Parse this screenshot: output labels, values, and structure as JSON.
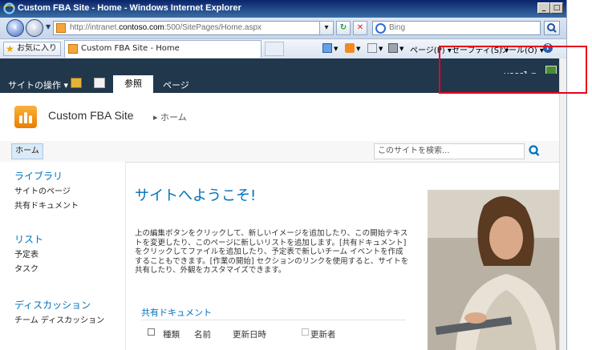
{
  "browser": {
    "window_title": "Custom FBA Site - Home - Windows Internet Explorer",
    "window_controls": [
      "_",
      "□",
      "×"
    ],
    "url_prefix": "http://intranet.",
    "url_domain": "contoso.com",
    "url_suffix": ":500/SitePages/Home.aspx",
    "search_placeholder": "Bing",
    "favorites_label": "お気に入り",
    "tab_label": "Custom FBA Site - Home",
    "cmd_page": "ページ(P)",
    "cmd_safety": "セーフティ(S)",
    "cmd_tools": "ツール(O)",
    "cmd_help": "?"
  },
  "ribbon": {
    "site_actions": "サイトの操作",
    "tab_browse": "参照",
    "tab_page": "ページ",
    "user": "user1"
  },
  "site": {
    "title": "Custom FBA Site",
    "breadcrumb": "ホーム",
    "nav_home": "ホーム",
    "search_placeholder": "このサイトを検索..."
  },
  "leftnav": {
    "libraries_heading": "ライブラリ",
    "site_pages": "サイトのページ",
    "shared_docs": "共有ドキュメント",
    "lists_heading": "リスト",
    "calendar": "予定表",
    "tasks": "タスク",
    "discussions_heading": "ディスカッション",
    "team_discussion": "チーム ディスカッション"
  },
  "main": {
    "welcome": "サイトへようこそ!",
    "description": "上の編集ボタンをクリックして、新しいイメージを追加したり、この開始テキストを変更したり、このページに新しいリストを追加します。[共有ドキュメント] をクリックしてファイルを追加したり、予定表で新しいチーム イベントを作成することもできます。[作業の開始] セクションのリンクを使用すると、サイトを共有したり、外観をカスタマイズできます。",
    "docs_title": "共有ドキュメント",
    "col_type": "種類",
    "col_name": "名前",
    "col_modified": "更新日時",
    "col_modified_by": "更新者"
  },
  "colors": {
    "ribbon_bg": "#21374c",
    "link_blue": "#0072bc",
    "highlight_red": "#e8001c"
  }
}
